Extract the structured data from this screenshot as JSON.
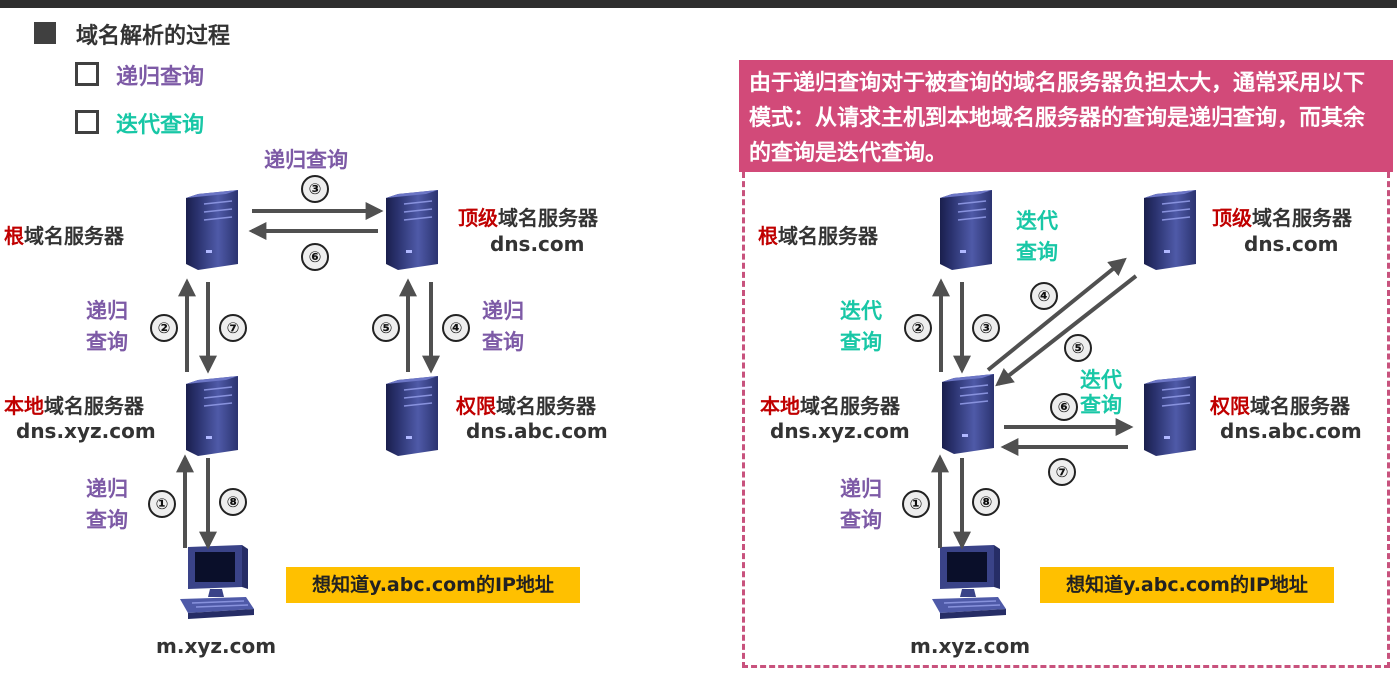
{
  "header": {
    "title": "域名解析的过程",
    "items": [
      {
        "label": "递归查询"
      },
      {
        "label": "迭代查询"
      }
    ]
  },
  "colors": {
    "recursive": "#7d5aa6",
    "iterative": "#18c7a6",
    "emphasis": "#c00000",
    "note_bg": "#d24a79",
    "highlight": "#ffc000"
  },
  "left_diagram": {
    "root": {
      "prefix": "根",
      "suffix": "域名服务器"
    },
    "tld": {
      "prefix": "顶级",
      "suffix": "域名服务器",
      "host": "dns.com"
    },
    "local": {
      "prefix": "本地",
      "suffix": "域名服务器",
      "host": "dns.xyz.com"
    },
    "auth": {
      "prefix": "权限",
      "suffix": "域名服务器",
      "host": "dns.abc.com"
    },
    "client": {
      "host": "m.xyz.com"
    },
    "query_top": "递归查询",
    "query_root_local": {
      "line1": "递归",
      "line2": "查询"
    },
    "query_tld_auth": {
      "line1": "递归",
      "line2": "查询"
    },
    "query_client": {
      "line1": "递归",
      "line2": "查询"
    },
    "steps": [
      "①",
      "②",
      "③",
      "④",
      "⑤",
      "⑥",
      "⑦",
      "⑧"
    ],
    "highlight": "想知道y.abc.com的IP地址"
  },
  "right_diagram": {
    "note": "由于递归查询对于被查询的域名服务器负担太大，通常采用以下模式：从请求主机到本地域名服务器的查询是递归查询，而其余的查询是迭代查询。",
    "root": {
      "prefix": "根",
      "suffix": "域名服务器"
    },
    "tld": {
      "prefix": "顶级",
      "suffix": "域名服务器",
      "host": "dns.com"
    },
    "local": {
      "prefix": "本地",
      "suffix": "域名服务器",
      "host": "dns.xyz.com"
    },
    "auth": {
      "prefix": "权限",
      "suffix": "域名服务器",
      "host": "dns.abc.com"
    },
    "client": {
      "host": "m.xyz.com"
    },
    "query_root": {
      "line1": "迭代",
      "line2": "查询"
    },
    "query_local_root": {
      "line1": "迭代",
      "line2": "查询"
    },
    "query_auth": {
      "line1": "迭代",
      "line2": "查询"
    },
    "query_client": {
      "line1": "递归",
      "line2": "查询"
    },
    "steps": [
      "①",
      "②",
      "③",
      "④",
      "⑤",
      "⑥",
      "⑦",
      "⑧"
    ],
    "highlight": "想知道y.abc.com的IP地址"
  }
}
